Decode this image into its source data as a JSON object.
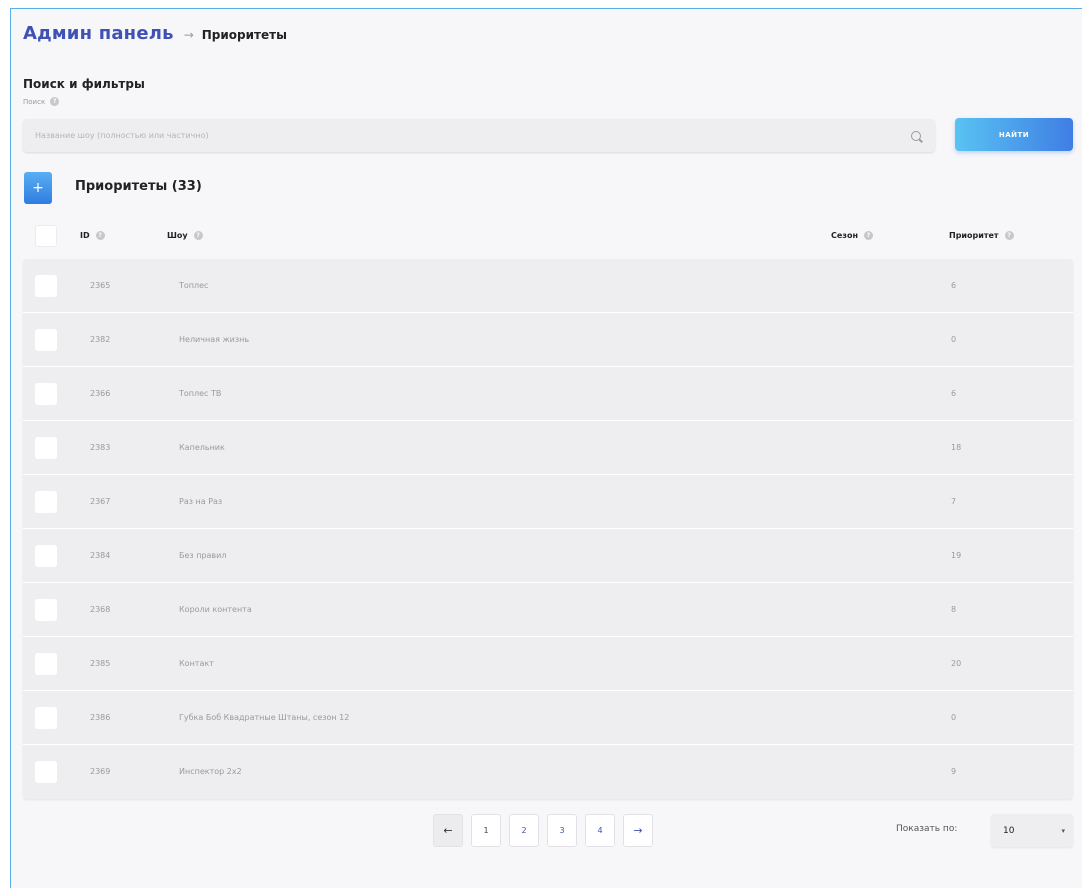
{
  "header": {
    "brand": "Админ панель",
    "separator": "→",
    "breadcrumb": "Приоритеты"
  },
  "filters": {
    "title": "Поиск и фильтры",
    "search_label": "Поиск",
    "search_placeholder": "Название шоу (полностью или частично)",
    "search_value": "",
    "find_label": "НАЙТИ"
  },
  "section": {
    "add_label": "+",
    "title": "Приоритеты (33)"
  },
  "table": {
    "headers": {
      "id": "ID",
      "show": "Шоу",
      "season": "Сезон",
      "priority": "Приоритет"
    },
    "rows": [
      {
        "id": "2365",
        "show": "Топлес",
        "season": "",
        "priority": "6"
      },
      {
        "id": "2382",
        "show": "Неличная жизнь",
        "season": "",
        "priority": "0"
      },
      {
        "id": "2366",
        "show": "Топлес ТВ",
        "season": "",
        "priority": "6"
      },
      {
        "id": "2383",
        "show": "Капельник",
        "season": "",
        "priority": "18"
      },
      {
        "id": "2367",
        "show": "Раз на Раз",
        "season": "",
        "priority": "7"
      },
      {
        "id": "2384",
        "show": "Без правил",
        "season": "",
        "priority": "19"
      },
      {
        "id": "2368",
        "show": "Короли контента",
        "season": "",
        "priority": "8"
      },
      {
        "id": "2385",
        "show": "Контакт",
        "season": "",
        "priority": "20"
      },
      {
        "id": "2386",
        "show": "Губка Боб Квадратные Штаны, сезон 12",
        "season": "",
        "priority": "0"
      },
      {
        "id": "2369",
        "show": "Инспектор 2х2",
        "season": "",
        "priority": "9"
      }
    ]
  },
  "pagination": {
    "prev": "←",
    "pages": [
      "1",
      "2",
      "3",
      "4"
    ],
    "current": "1",
    "next": "→"
  },
  "page_size": {
    "label": "Показать по:",
    "value": "10",
    "chevron": "▾"
  },
  "colors": {
    "brand": "#3f51b5",
    "accent_gradient_start": "#59c3f2",
    "accent_gradient_end": "#3f7ee4"
  },
  "icons": {
    "help": "help-circle-icon",
    "search": "search-icon",
    "add": "plus-icon",
    "prev": "arrow-left-icon",
    "next": "arrow-right-icon",
    "dropdown": "chevron-down-icon"
  }
}
